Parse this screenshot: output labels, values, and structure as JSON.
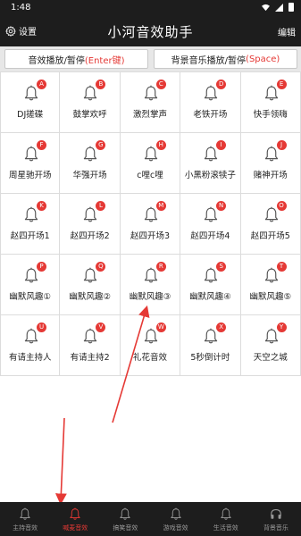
{
  "status_bar": {
    "time": "1:48"
  },
  "header": {
    "settings_label": "设置",
    "title": "小河音效助手",
    "edit_label": "编辑"
  },
  "controls": {
    "sfx_label": "音效播放/暂停",
    "sfx_hotkey": "(Enter键)",
    "bgm_label": "背景音乐播放/暂停",
    "bgm_hotkey": "(Space)"
  },
  "colors": {
    "accent": "#e53935",
    "bar_bg": "#1d1d1d",
    "grid_line": "#dcdcdc"
  },
  "sound_grid": [
    [
      {
        "key": "A",
        "label": "DJ搓碟"
      },
      {
        "key": "B",
        "label": "鼓掌欢呼"
      },
      {
        "key": "C",
        "label": "激烈掌声"
      },
      {
        "key": "D",
        "label": "老铁开场"
      },
      {
        "key": "E",
        "label": "快手领嗨"
      }
    ],
    [
      {
        "key": "F",
        "label": "周星驰开场"
      },
      {
        "key": "G",
        "label": "华强开场"
      },
      {
        "key": "H",
        "label": "c哩c哩"
      },
      {
        "key": "I",
        "label": "小黑粉滚犊子"
      },
      {
        "key": "J",
        "label": "赌神开场"
      }
    ],
    [
      {
        "key": "K",
        "label": "赵四开场1"
      },
      {
        "key": "L",
        "label": "赵四开场2"
      },
      {
        "key": "M",
        "label": "赵四开场3"
      },
      {
        "key": "N",
        "label": "赵四开场4"
      },
      {
        "key": "O",
        "label": "赵四开场5"
      }
    ],
    [
      {
        "key": "P",
        "label": "幽默风趣①"
      },
      {
        "key": "Q",
        "label": "幽默风趣②"
      },
      {
        "key": "R",
        "label": "幽默风趣③"
      },
      {
        "key": "S",
        "label": "幽默风趣④"
      },
      {
        "key": "T",
        "label": "幽默风趣⑤"
      }
    ],
    [
      {
        "key": "U",
        "label": "有请主持人"
      },
      {
        "key": "V",
        "label": "有请主持2"
      },
      {
        "key": "W",
        "label": "礼花音效"
      },
      {
        "key": "X",
        "label": "5秒倒计时"
      },
      {
        "key": "Y",
        "label": "天空之城"
      }
    ]
  ],
  "bottom_nav": [
    {
      "label": "主持音效",
      "active": false,
      "icon": "bell-icon"
    },
    {
      "label": "喊麦音效",
      "active": true,
      "icon": "bell-icon"
    },
    {
      "label": "搞笑音效",
      "active": false,
      "icon": "bell-icon"
    },
    {
      "label": "游戏音效",
      "active": false,
      "icon": "bell-icon"
    },
    {
      "label": "生活音效",
      "active": false,
      "icon": "bell-icon"
    },
    {
      "label": "背景音乐",
      "active": false,
      "icon": "headphones-icon"
    }
  ]
}
